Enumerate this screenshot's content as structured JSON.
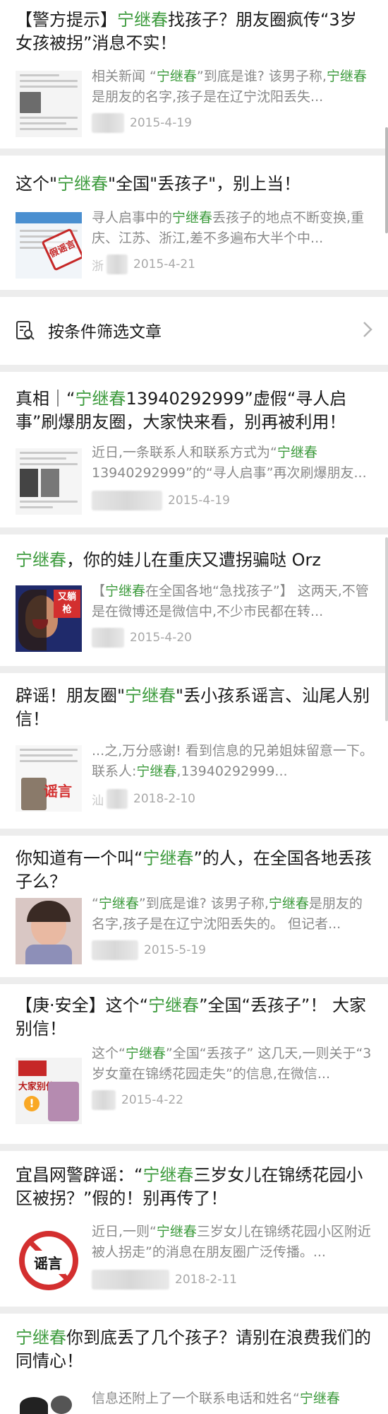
{
  "filter_row": {
    "label": "按条件筛选文章"
  },
  "articles": [
    {
      "title": [
        "【警方提示】",
        "宁继春",
        "找孩子？朋友圈疯传“3岁女孩被拐”消息不实！"
      ],
      "summary": [
        "相关新闻 “",
        "宁继春",
        "”到底是谁? 该男子称,",
        "宁继春",
        "是朋友的名字,孩子是在辽宁沈阳丢失..."
      ],
      "date": "2015-4-19",
      "thumb_icon": "news-screenshot-thumbnail"
    },
    {
      "title": [
        "这个\"",
        "宁继春",
        "\"全国\"丢孩子\"，别上当！"
      ],
      "summary": [
        "寻人启事中的",
        "宁继春",
        "丢孩子的地点不断变换,重庆、江苏、浙江,差不多遍布大半个中..."
      ],
      "date": "2015-4-21",
      "source_prefix": "浙",
      "thumb_icon": "rumor-stamp-thumbnail",
      "stamp_text": "假谣言"
    },
    {
      "title": [
        "真相｜“",
        "宁继春",
        "13940292999”虚假“寻人启事”刷爆朋友圈，大家快来看，别再被利用！"
      ],
      "summary": [
        "近日,一条联系人和联系方式为“",
        "宁继春",
        " 13940292999”的“寻人启事”再次刷爆朋友..."
      ],
      "date": "2015-4-19",
      "thumb_icon": "missing-notice-thumbnail"
    },
    {
      "title": [
        "",
        "宁继春",
        "，你的娃儿在重庆又遭拐骗哒 Orz"
      ],
      "summary": [
        "【",
        "宁继春",
        "在全国各地“急找孩子”】 这两天,不管是在微博还是微信中,不少市民都在转..."
      ],
      "date": "2015-4-20",
      "thumb_icon": "crying-woman-thumbnail",
      "badge_text": "又躺枪"
    },
    {
      "title": [
        "辟谣！朋友圈\"",
        "宁继春",
        "\"丢小孩系谣言、汕尾人别信！"
      ],
      "summary": [
        "...之,万分感谢! 看到信息的兄弟姐妹留意一下。 联系人:",
        "宁继春",
        ",13940292999..."
      ],
      "date": "2018-2-10",
      "source_prefix": "汕",
      "thumb_icon": "rumor-label-thumbnail",
      "badge_text": "谣言"
    },
    {
      "title": [
        "你知道有一个叫“",
        "宁继春",
        "”的人，在全国各地丢孩子么？"
      ],
      "summary": [
        "“",
        "宁继春",
        "”到底是谁? 该男子称,",
        "宁继春",
        "是朋友的名字,孩子是在辽宁沈阳丢失的。 但记者..."
      ],
      "date": "2015-5-19",
      "thumb_icon": "child-photo-thumbnail"
    },
    {
      "title": [
        "【庚·安全】这个“",
        "宁继春",
        "”全国“丢孩子”！ 大家别信！"
      ],
      "summary": [
        "这个“",
        "宁继春",
        "”全国“丢孩子” 这几天,一则关于“3岁女童在锦绣花园走失”的信息,在微信..."
      ],
      "date": "2015-4-22",
      "thumb_icon": "warning-poster-thumbnail",
      "poster_text": "大家别信!"
    },
    {
      "title": [
        "宜昌网警辟谣：“",
        "宁继春",
        "三岁女儿在锦绣花园小区被拐？”假的！别再传了！"
      ],
      "summary": [
        "近日,一则“",
        "宁继春",
        "三岁女儿在锦绣花园小区附近被人拐走”的消息在朋友圈广泛传播。..."
      ],
      "date": "2018-2-11",
      "thumb_icon": "rumor-prohibited-thumbnail",
      "badge_text": "谣言"
    },
    {
      "title": [
        "",
        "宁继春",
        "你到底丢了几个孩子？请别在浪费我们的同情心！"
      ],
      "summary": [
        "信息还附上了一个联系电话和姓名“",
        "宁继春",
        ""
      ],
      "thumb_icon": "comic-thumbnail"
    }
  ],
  "colors": {
    "highlight": "#3d9b3d",
    "meta": "#a8a8a8",
    "summary": "#8a8a8a",
    "background": "#ededed"
  }
}
